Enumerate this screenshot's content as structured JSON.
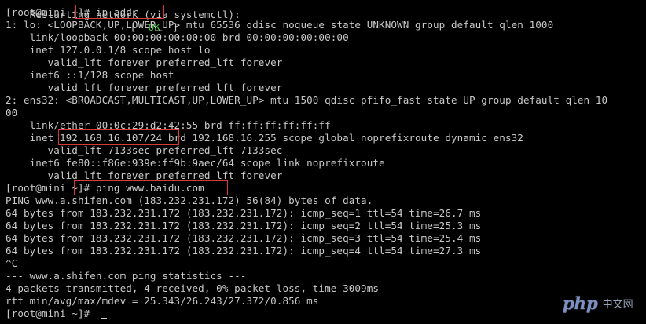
{
  "terminal": {
    "lines": [
      {
        "text": "Restarting network (via systemctl):",
        "status_open": "[",
        "status": "  OK  ",
        "status_close": "]"
      },
      {
        "text": "[root@mini ~]# ip addr"
      },
      {
        "text": "1: lo: <LOOPBACK,UP,LOWER_UP> mtu 65536 qdisc noqueue state UNKNOWN group default qlen 1000"
      },
      {
        "text": "    link/loopback 00:00:00:00:00:00 brd 00:00:00:00:00:00"
      },
      {
        "text": "    inet 127.0.0.1/8 scope host lo"
      },
      {
        "text": "       valid_lft forever preferred_lft forever"
      },
      {
        "text": "    inet6 ::1/128 scope host"
      },
      {
        "text": "       valid_lft forever preferred_lft forever"
      },
      {
        "text": "2: ens32: <BROADCAST,MULTICAST,UP,LOWER_UP> mtu 1500 qdisc pfifo_fast state UP group default qlen 10"
      },
      {
        "text": "00"
      },
      {
        "text": "    link/ether 00:0c:29:d2:42:55 brd ff:ff:ff:ff:ff:ff"
      },
      {
        "text": "    inet 192.168.16.107/24 brd 192.168.16.255 scope global noprefixroute dynamic ens32"
      },
      {
        "text": "       valid_lft 7133sec preferred_lft 7133sec"
      },
      {
        "text": "    inet6 fe80::f86e:939e:ff9b:9aec/64 scope link noprefixroute"
      },
      {
        "text": "       valid_lft forever preferred_lft forever"
      },
      {
        "text": "[root@mini ~]# ping www.baidu.com"
      },
      {
        "text": "PING www.a.shifen.com (183.232.231.172) 56(84) bytes of data."
      },
      {
        "text": "64 bytes from 183.232.231.172 (183.232.231.172): icmp_seq=1 ttl=54 time=26.7 ms"
      },
      {
        "text": "64 bytes from 183.232.231.172 (183.232.231.172): icmp_seq=2 ttl=54 time=25.3 ms"
      },
      {
        "text": "64 bytes from 183.232.231.172 (183.232.231.172): icmp_seq=3 ttl=54 time=25.4 ms"
      },
      {
        "text": "64 bytes from 183.232.231.172 (183.232.231.172): icmp_seq=4 ttl=54 time=27.3 ms"
      },
      {
        "text": "^C"
      },
      {
        "text": "--- www.a.shifen.com ping statistics ---"
      },
      {
        "text": "4 packets transmitted, 4 received, 0% packet loss, time 3009ms"
      },
      {
        "text": "rtt min/avg/max/mdev = 25.343/26.243/27.372/0.856 ms"
      },
      {
        "text": "[root@mini ~]# "
      }
    ]
  },
  "watermark": {
    "logo": "php",
    "site": "中文网"
  },
  "colors": {
    "background": "#000000",
    "foreground": "#c8c8c8",
    "ok": "#3ec43e",
    "highlight_box": "#d83a3a"
  }
}
